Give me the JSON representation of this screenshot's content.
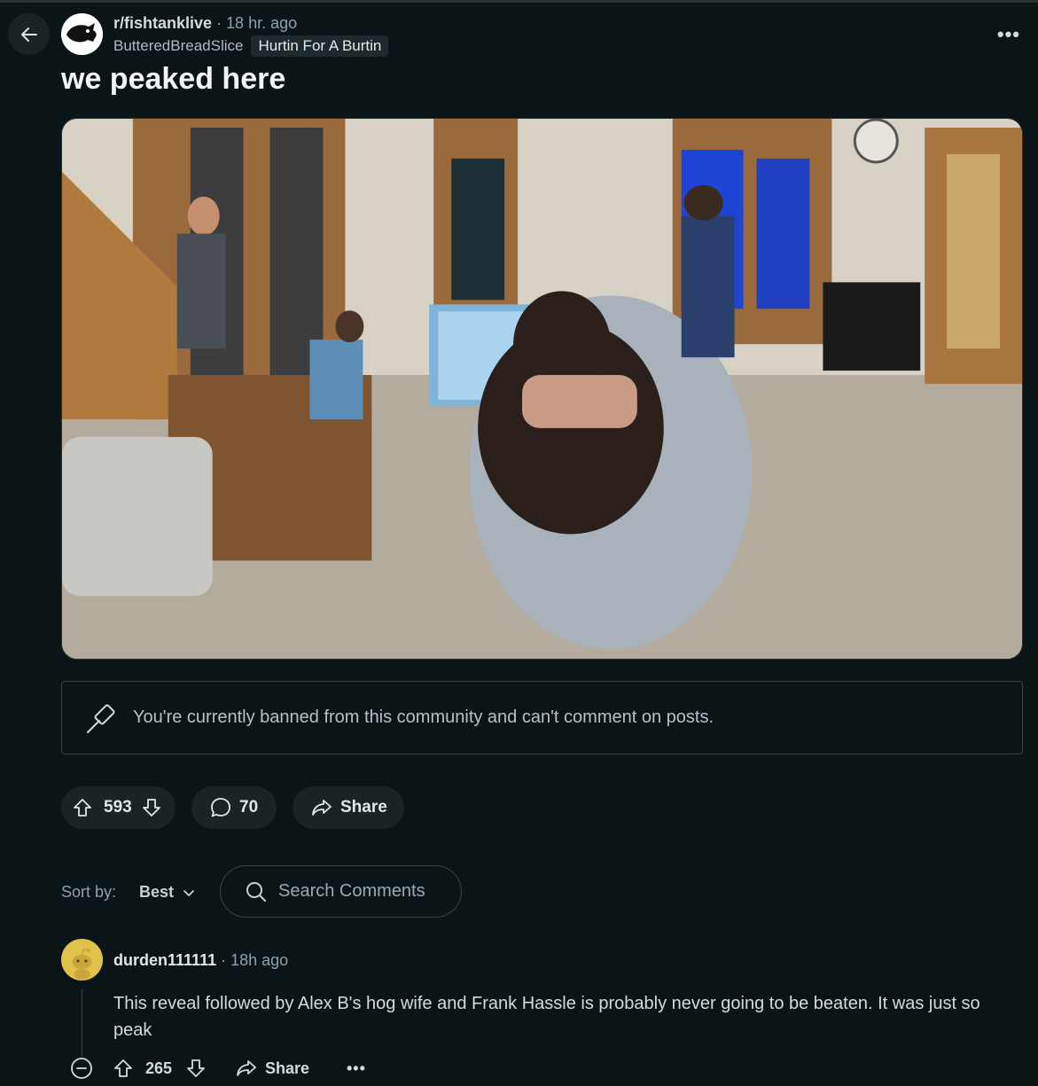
{
  "post": {
    "subreddit": "r/fishtanklive",
    "time": "18 hr. ago",
    "author": "ButteredBreadSlice",
    "flair": "Hurtin For A Burtin",
    "title": "we peaked here",
    "menu_glyph": "•••"
  },
  "banned_notice": {
    "text": "You're currently banned from this community and can't comment on posts.",
    "icon": "gavel-icon"
  },
  "actions": {
    "score": "593",
    "comments": "70",
    "share_label": "Share"
  },
  "sort": {
    "label": "Sort by:",
    "value": "Best"
  },
  "search": {
    "placeholder": "Search Comments"
  },
  "comment": {
    "author": "durden111111",
    "time": "18h ago",
    "body": "This reveal followed by Alex B's hog wife and Frank Hassle is probably never going to be beaten. It was just so peak",
    "score": "265",
    "share_label": "Share",
    "more_glyph": "•••"
  },
  "colors": {
    "background": "#0b1416",
    "pill": "#1a2326",
    "muted_text": "#8ba2ad",
    "avatar_yellow": "#e0c14a"
  }
}
